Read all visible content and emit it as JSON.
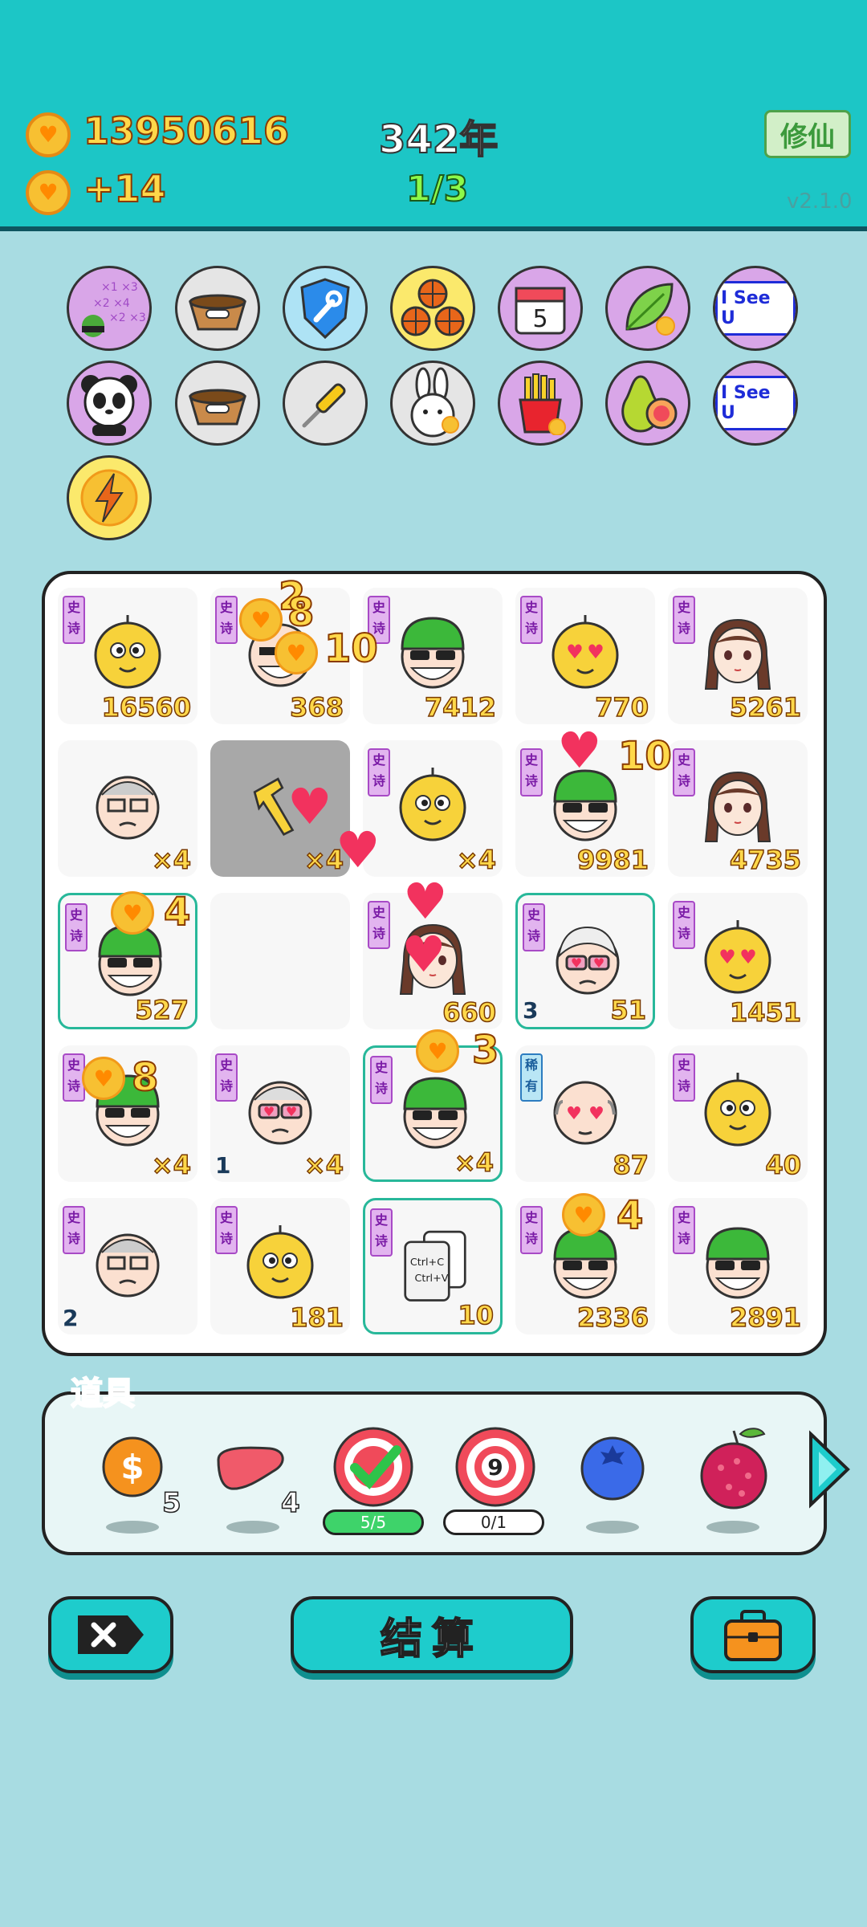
{
  "header": {
    "coins": "13950616",
    "income": "+14",
    "year": "342年",
    "progress": "1/3",
    "xiuxian_label": "修仙",
    "version": "v2.1.0"
  },
  "pets": {
    "row1": [
      "math-pet-icon",
      "dog-food-bowl-icon",
      "wrench-shield-icon",
      "basketballs-icon",
      "calendar-icon",
      "leaf-icon",
      "i-see-u-icon"
    ],
    "row2": [
      "panda-icon",
      "dog-food-bowl-icon",
      "screwdriver-icon",
      "rabbit-icon",
      "fries-icon",
      "pear-icon",
      "i-see-u-icon"
    ],
    "row3": [
      "lightning-icon"
    ],
    "calendar_number": "5",
    "iseeu_label": "I See U"
  },
  "board": {
    "tag_text": "史诗",
    "rare_tag_text": "稀有",
    "cells": [
      {
        "value": "16560",
        "face": "yellow"
      },
      {
        "value": "368",
        "face": "grandpa"
      },
      {
        "value": "7412",
        "face": "green-hat"
      },
      {
        "value": "770",
        "face": "yellow-love"
      },
      {
        "value": "5261",
        "face": "girl"
      },
      {
        "value": "×4",
        "face": "grandpa-glasses"
      },
      {
        "value": "×4",
        "face": "pointer"
      },
      {
        "value": "×4",
        "face": "yellow"
      },
      {
        "value": "9981",
        "face": "green-hat"
      },
      {
        "value": "4735",
        "face": "girl"
      },
      {
        "value": "527",
        "face": "green-hat"
      },
      {
        "value": "",
        "face": "empty"
      },
      {
        "value": "660",
        "face": "girl"
      },
      {
        "value": "51",
        "face": "grandma-love"
      },
      {
        "value": "1451",
        "face": "yellow-love"
      },
      {
        "value": "×4",
        "face": "green-hat"
      },
      {
        "value": "×4",
        "face": "grandpa-love"
      },
      {
        "value": "×4",
        "face": "green-hat"
      },
      {
        "value": "87",
        "face": "bald-love"
      },
      {
        "value": "40",
        "face": "yellow"
      },
      {
        "value": "",
        "face": "grandpa-glasses"
      },
      {
        "value": "181",
        "face": "yellow"
      },
      {
        "value": "10",
        "face": "ctrl-cv"
      },
      {
        "value": "2336",
        "face": "green-hat"
      },
      {
        "value": "2891",
        "face": "green-hat"
      }
    ],
    "levels": {
      "c13": "3",
      "c16": "1",
      "c20": "2"
    },
    "floats": {
      "f1": "2",
      "f2": "8",
      "f3": "10",
      "f4": "10",
      "f5": "4",
      "f6": "3",
      "f7": "8",
      "f8": "4"
    },
    "ctrl_text_1": "Ctrl+C",
    "ctrl_text_2": "Ctrl+V"
  },
  "props": {
    "label": "道具",
    "items": [
      {
        "icon": "dollar-coin-icon",
        "count": "5"
      },
      {
        "icon": "liver-icon",
        "count": "4"
      },
      {
        "icon": "target-check-icon",
        "pill": "5/5"
      },
      {
        "icon": "target-nine-icon",
        "pill": "0/1",
        "number": "9"
      },
      {
        "icon": "blueberry-icon"
      },
      {
        "icon": "lychee-icon"
      }
    ]
  },
  "buttons": {
    "settle_label": "结算"
  },
  "colors": {
    "header_bg": "#1cc6c6",
    "body_bg": "#a8dce2",
    "accent": "#1ecccc"
  }
}
